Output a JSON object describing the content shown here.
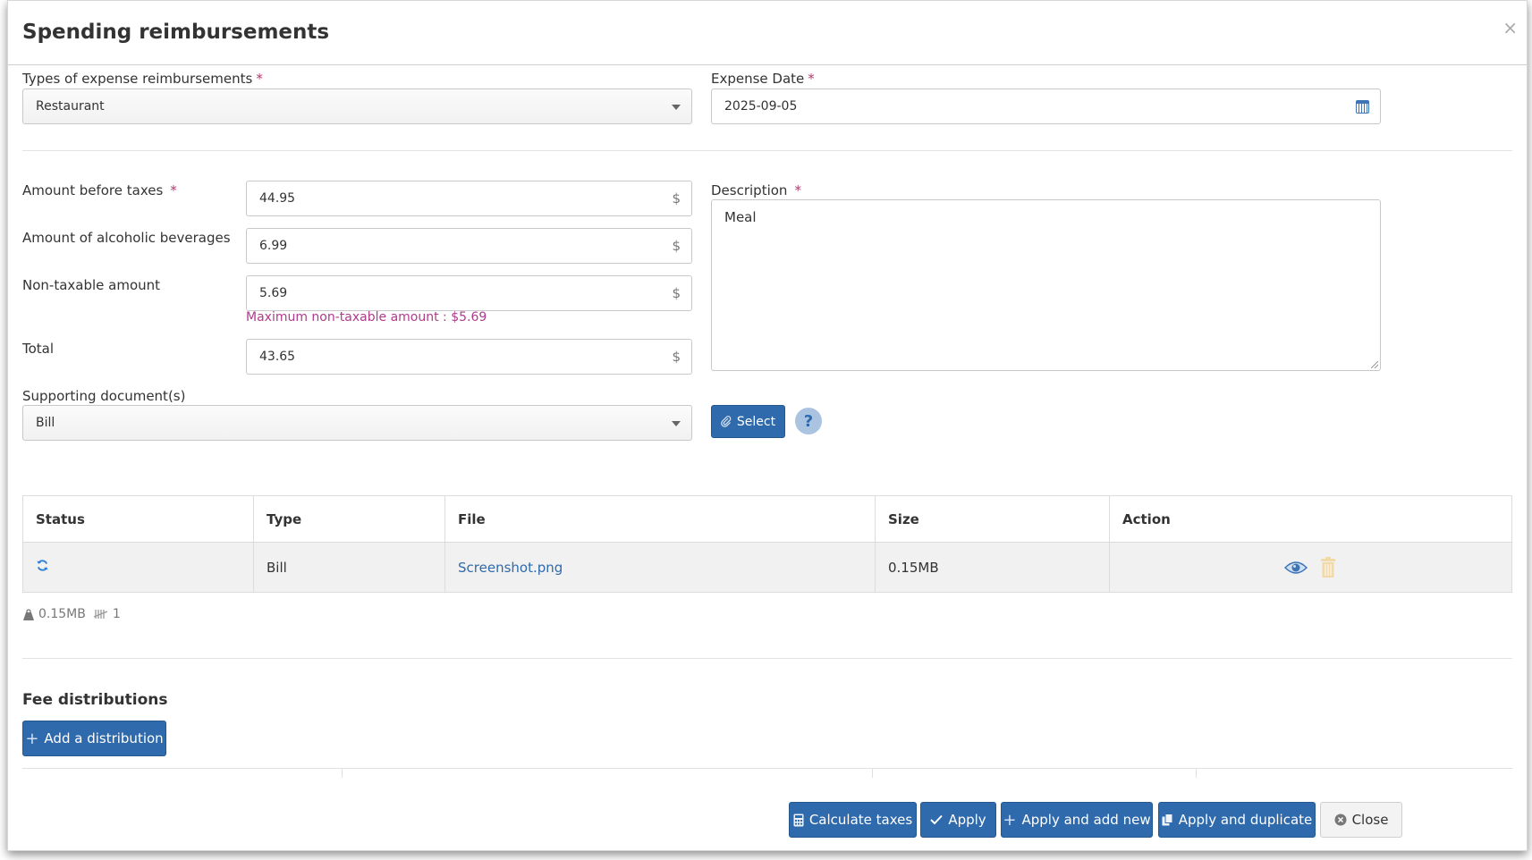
{
  "dialog": {
    "title": "Spending reimbursements",
    "close_glyph": "×"
  },
  "form": {
    "expense_type": {
      "label": "Types of expense reimbursements",
      "required": "*",
      "value": "Restaurant"
    },
    "expense_date": {
      "label": "Expense Date",
      "required": "*",
      "value": "2025-09-05"
    },
    "amount_before_taxes": {
      "label": "Amount before taxes",
      "required": "*",
      "value": "44.95",
      "unit": "$"
    },
    "alcohol_amount": {
      "label": "Amount of alcoholic beverages",
      "value": "6.99",
      "unit": "$"
    },
    "non_taxable_amount": {
      "label": "Non-taxable amount",
      "value": "5.69",
      "unit": "$",
      "hint": "Maximum non-taxable amount : $5.69"
    },
    "total": {
      "label": "Total",
      "value": "43.65",
      "unit": "$"
    },
    "description": {
      "label": "Description",
      "required": "*",
      "value": "Meal"
    },
    "supporting_docs": {
      "label": "Supporting document(s)",
      "value": "Bill",
      "select_label": "Select",
      "help_glyph": "?"
    }
  },
  "documents_table": {
    "headers": [
      "Status",
      "Type",
      "File",
      "Size",
      "Action"
    ],
    "rows": [
      {
        "status_icon": "refresh-icon",
        "type": "Bill",
        "file": "Screenshot.png",
        "size": "0.15MB"
      }
    ],
    "summary": {
      "total_size": "0.15MB",
      "count": "1"
    }
  },
  "fee_distributions": {
    "title": "Fee distributions",
    "add_label": "Add a distribution"
  },
  "footer": {
    "calculate_taxes": "Calculate taxes",
    "apply": "Apply",
    "apply_add_new": "Apply and add new",
    "apply_duplicate": "Apply and duplicate",
    "close": "Close"
  },
  "colors": {
    "primary": "#2f6aad",
    "required": "#b03a6d",
    "hint": "#b03a8c",
    "row_bg": "#f1f1f1",
    "trash_icon": "#f2d9a8"
  }
}
